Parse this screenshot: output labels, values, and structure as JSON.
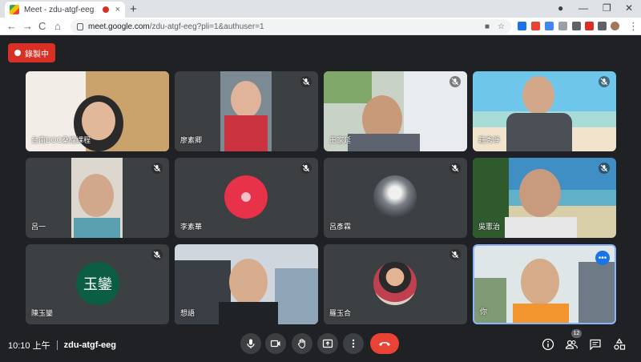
{
  "browser": {
    "tab_title": "Meet - zdu-atgf-eeg",
    "tab_close": "×",
    "new_tab": "+",
    "url_host": "meet.google.com",
    "url_path": "/zdu-atgf-eeg?pli=1&authuser=1",
    "back": "←",
    "forward": "→",
    "reload": "C",
    "home": "⌂",
    "minimize": "—",
    "maximize": "❐",
    "close": "✕",
    "menu": "⋮"
  },
  "meet": {
    "recording_label": "錄製中",
    "time": "10:10 上午",
    "meeting_code": "zdu-atgf-eeg",
    "participant_count": "12",
    "self_more": "•••",
    "tiles": [
      {
        "name": "台南DOC桑榆課程"
      },
      {
        "name": "廖素卿"
      },
      {
        "name": "王家延"
      },
      {
        "name": "莊秀淨"
      },
      {
        "name": "呂一"
      },
      {
        "name": "李素華"
      },
      {
        "name": "呂彥霖"
      },
      {
        "name": "吳憲治"
      },
      {
        "name": "陳玉鑾",
        "avatar_text": "玉鑾",
        "avatar_color": "#0b5e44"
      },
      {
        "name": "想語"
      },
      {
        "name": "羅玉合"
      },
      {
        "name": "你"
      }
    ]
  },
  "colors": {
    "background": "#202124",
    "tile": "#3c4043",
    "recording": "#d93025",
    "end_call": "#ea4335",
    "self_border": "#8ab4f8"
  }
}
